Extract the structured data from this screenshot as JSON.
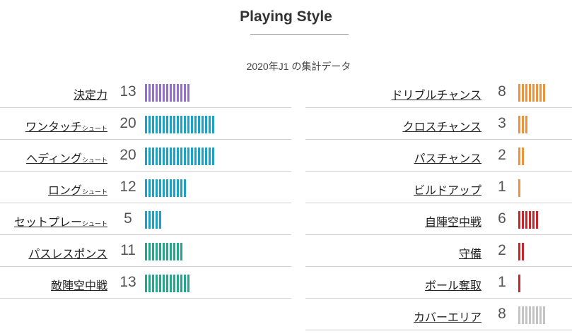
{
  "header": {
    "title": "Playing Style",
    "subtitle": "2020年J1 の集計データ"
  },
  "left_stats": [
    {
      "label": "決定力",
      "suffix": "",
      "value": 13,
      "color": "#9370cc"
    },
    {
      "label": "ワンタッチ",
      "suffix": "シュート",
      "value": 20,
      "color": "#1aa3c8"
    },
    {
      "label": "ヘディング",
      "suffix": "シュート",
      "value": 20,
      "color": "#1aa3c8"
    },
    {
      "label": "ロング",
      "suffix": "シュート",
      "value": 12,
      "color": "#1aa3c8"
    },
    {
      "label": "セットプレー",
      "suffix": "シュート",
      "value": 5,
      "color": "#1aa3c8"
    },
    {
      "label": "パスレスポンス",
      "suffix": "",
      "value": 11,
      "color": "#22a88a"
    },
    {
      "label": "敵陣空中戦",
      "suffix": "",
      "value": 13,
      "color": "#22a88a"
    }
  ],
  "right_stats": [
    {
      "label": "ドリブルチャンス",
      "suffix": "",
      "value": 8,
      "color": "#f0923a"
    },
    {
      "label": "クロスチャンス",
      "suffix": "",
      "value": 3,
      "color": "#f0923a"
    },
    {
      "label": "パスチャンス",
      "suffix": "",
      "value": 2,
      "color": "#f0923a"
    },
    {
      "label": "ビルドアップ",
      "suffix": "",
      "value": 1,
      "color": "#f0923a"
    },
    {
      "label": "自陣空中戦",
      "suffix": "",
      "value": 6,
      "color": "#c8262a"
    },
    {
      "label": "守備",
      "suffix": "",
      "value": 2,
      "color": "#c8262a"
    },
    {
      "label": "ボール奪取",
      "suffix": "",
      "value": 1,
      "color": "#c8262a"
    },
    {
      "label": "カバーエリア",
      "suffix": "",
      "value": 8,
      "color": "#c4c4c4"
    }
  ]
}
